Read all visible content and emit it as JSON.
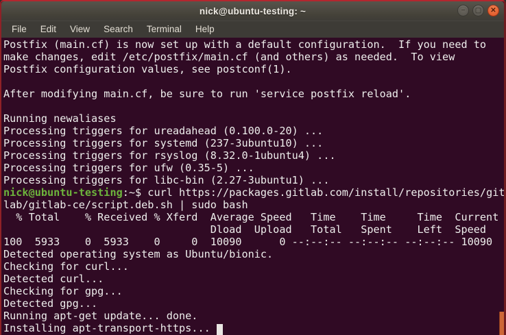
{
  "window": {
    "title": "nick@ubuntu-testing: ~",
    "buttons": [
      {
        "name": "minimize",
        "glyph": "−"
      },
      {
        "name": "maximize",
        "glyph": "▢"
      },
      {
        "name": "close",
        "glyph": "✕"
      }
    ]
  },
  "menu": {
    "items": [
      "File",
      "Edit",
      "View",
      "Search",
      "Terminal",
      "Help"
    ]
  },
  "colors": {
    "terminal_background": "#300a24",
    "terminal_text": "#eeeeec",
    "prompt_green": "#6db43c",
    "close_button_orange": "#dd5427",
    "scrollbar_thumb_orange": "#cd6737",
    "window_border_red": "#b3262e"
  },
  "terminal": {
    "lines": [
      {
        "segs": [
          {
            "type": "text",
            "text": "Postfix (main.cf) is now set up with a default configuration.  If you need to"
          }
        ]
      },
      {
        "segs": [
          {
            "type": "text",
            "text": "make changes, edit /etc/postfix/main.cf (and others) as needed.  To view"
          }
        ]
      },
      {
        "segs": [
          {
            "type": "text",
            "text": "Postfix configuration values, see postconf(1)."
          }
        ]
      },
      {
        "segs": [
          {
            "type": "text",
            "text": ""
          }
        ]
      },
      {
        "segs": [
          {
            "type": "text",
            "text": "After modifying main.cf, be sure to run 'service postfix reload'."
          }
        ]
      },
      {
        "segs": [
          {
            "type": "text",
            "text": ""
          }
        ]
      },
      {
        "segs": [
          {
            "type": "text",
            "text": "Running newaliases"
          }
        ]
      },
      {
        "segs": [
          {
            "type": "text",
            "text": "Processing triggers for ureadahead (0.100.0-20) ..."
          }
        ]
      },
      {
        "segs": [
          {
            "type": "text",
            "text": "Processing triggers for systemd (237-3ubuntu10) ..."
          }
        ]
      },
      {
        "segs": [
          {
            "type": "text",
            "text": "Processing triggers for rsyslog (8.32.0-1ubuntu4) ..."
          }
        ]
      },
      {
        "segs": [
          {
            "type": "text",
            "text": "Processing triggers for ufw (0.35-5) ..."
          }
        ]
      },
      {
        "segs": [
          {
            "type": "text",
            "text": "Processing triggers for libc-bin (2.27-3ubuntu1) ..."
          }
        ]
      },
      {
        "segs": [
          {
            "type": "prompt",
            "text": "nick@ubuntu-testing"
          },
          {
            "type": "text",
            "text": ":~$ curl https://packages.gitlab.com/install/repositories/git"
          }
        ]
      },
      {
        "segs": [
          {
            "type": "text",
            "text": "lab/gitlab-ce/script.deb.sh | sudo bash"
          }
        ]
      },
      {
        "segs": [
          {
            "type": "text",
            "text": "  % Total    % Received % Xferd  Average Speed   Time    Time     Time  Current"
          }
        ]
      },
      {
        "segs": [
          {
            "type": "text",
            "text": "                                 Dload  Upload   Total   Spent    Left  Speed"
          }
        ]
      },
      {
        "segs": [
          {
            "type": "text",
            "text": "100  5933    0  5933    0     0  10090      0 --:--:-- --:--:-- --:--:-- 10090"
          }
        ]
      },
      {
        "segs": [
          {
            "type": "text",
            "text": "Detected operating system as Ubuntu/bionic."
          }
        ]
      },
      {
        "segs": [
          {
            "type": "text",
            "text": "Checking for curl..."
          }
        ]
      },
      {
        "segs": [
          {
            "type": "text",
            "text": "Detected curl..."
          }
        ]
      },
      {
        "segs": [
          {
            "type": "text",
            "text": "Checking for gpg..."
          }
        ]
      },
      {
        "segs": [
          {
            "type": "text",
            "text": "Detected gpg..."
          }
        ]
      },
      {
        "segs": [
          {
            "type": "text",
            "text": "Running apt-get update... done."
          }
        ]
      },
      {
        "segs": [
          {
            "type": "text",
            "text": "Installing apt-transport-https... "
          },
          {
            "type": "cursor",
            "text": ""
          }
        ]
      }
    ]
  }
}
